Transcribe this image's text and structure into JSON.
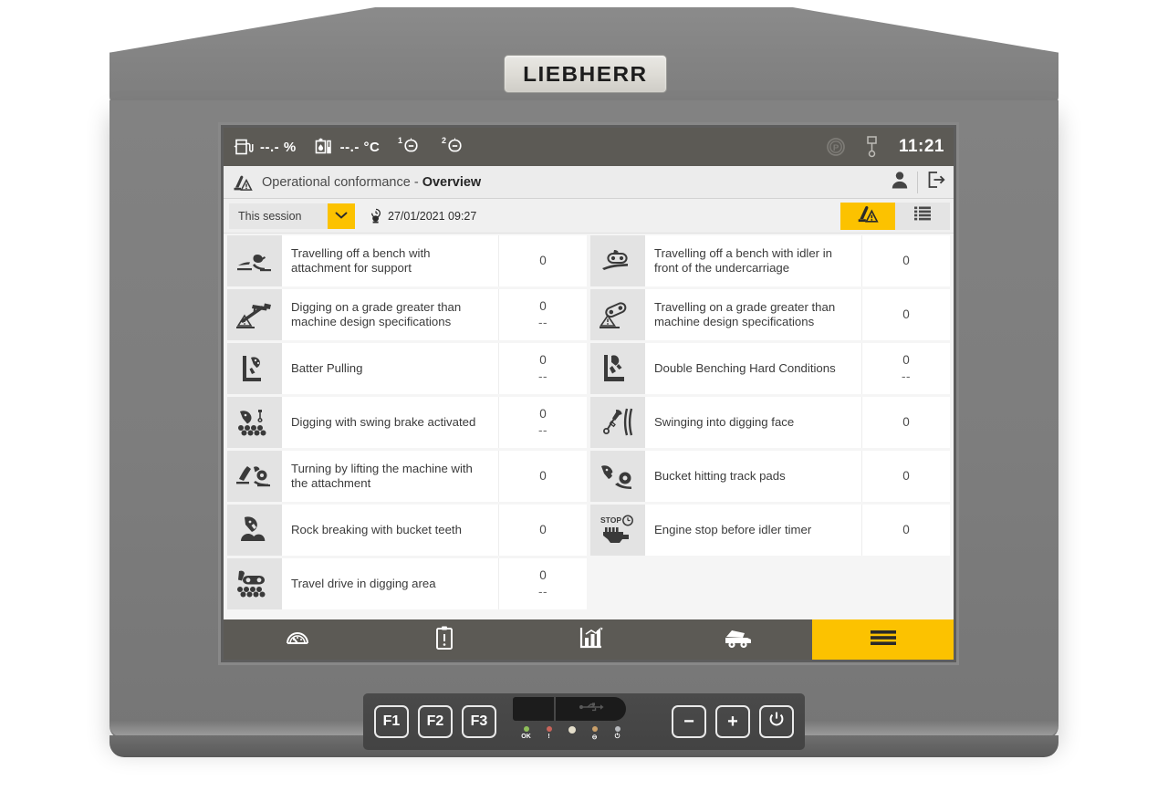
{
  "device": {
    "brand": "LIEBHERR"
  },
  "statusbar": {
    "fuel_icon": "fuel-pump-icon",
    "fuel_value": "--.- %",
    "temp_icon": "oil-temperature-icon",
    "temp_value": "--.- °C",
    "aux1_icon": "aux-tank-1-icon",
    "aux1_value": "--",
    "aux1_superscript": "1",
    "aux2_icon": "aux-tank-2-icon",
    "aux2_value": "--",
    "aux2_superscript": "2",
    "parking_icon": "parking-brake-icon",
    "joystick_icon": "pilot-control-lever-icon",
    "time": "11:21"
  },
  "titlebar": {
    "icon": "operational-conformance-icon",
    "title_prefix": "Operational conformance - ",
    "title_bold": "Overview",
    "user_icon": "user-icon",
    "logout_icon": "logout-icon"
  },
  "filterbar": {
    "session_select_value": "This session",
    "session_select_options": [
      "This session"
    ],
    "dropdown_icon": "chevron-down-icon",
    "date_icon": "clock-session-icon",
    "date_value": "27/01/2021 09:27",
    "view_toggle": [
      {
        "icon": "operational-conformance-icon",
        "active": true,
        "name": "view-conformance"
      },
      {
        "icon": "list-view-icon",
        "active": false,
        "name": "view-list"
      }
    ],
    "accent_color": "#fcc200"
  },
  "table": {
    "left_column": [
      {
        "icon": "travel-off-bench-attachment-icon",
        "label": "Travelling off a bench with attachment for support",
        "value": "0",
        "sub": ""
      },
      {
        "icon": "digging-grade-icon",
        "label": "Digging on a grade greater than machine design specifications",
        "value": "0",
        "sub": "--"
      },
      {
        "icon": "batter-pulling-icon",
        "label": "Batter Pulling",
        "value": "0",
        "sub": "--"
      },
      {
        "icon": "swing-brake-icon",
        "label": "Digging with swing brake activated",
        "value": "0",
        "sub": "--"
      },
      {
        "icon": "turning-by-lifting-icon",
        "label": "Turning by lifting the machine with the attachment",
        "value": "0",
        "sub": ""
      },
      {
        "icon": "rock-breaking-icon",
        "label": "Rock breaking with bucket teeth",
        "value": "0",
        "sub": ""
      },
      {
        "icon": "travel-drive-digging-icon",
        "label": "Travel drive in digging area",
        "value": "0",
        "sub": "--"
      }
    ],
    "right_column": [
      {
        "icon": "travel-off-bench-idler-icon",
        "label": "Travelling off a bench with idler in front of the undercarriage",
        "value": "0",
        "sub": ""
      },
      {
        "icon": "travel-grade-icon",
        "label": "Travelling on a grade greater than machine design specifications",
        "value": "0",
        "sub": ""
      },
      {
        "icon": "double-benching-icon",
        "label": "Double Benching Hard Conditions",
        "value": "0",
        "sub": "--"
      },
      {
        "icon": "swinging-digging-face-icon",
        "label": "Swinging into digging face",
        "value": "0",
        "sub": ""
      },
      {
        "icon": "bucket-track-pads-icon",
        "label": "Bucket hitting track pads",
        "value": "0",
        "sub": ""
      },
      {
        "icon": "engine-stop-idler-icon",
        "label": "Engine stop before idler timer",
        "value": "0",
        "sub": ""
      }
    ]
  },
  "navbar": {
    "items": [
      {
        "name": "nav-dashboard",
        "icon": "gauge-icon",
        "active": false
      },
      {
        "name": "nav-diagnostics",
        "icon": "clipboard-alert-icon",
        "active": false
      },
      {
        "name": "nav-statistics",
        "icon": "bar-chart-icon",
        "active": false
      },
      {
        "name": "nav-machine",
        "icon": "dump-truck-icon",
        "active": false
      },
      {
        "name": "nav-menu",
        "icon": "hamburger-menu-icon",
        "active": true
      }
    ]
  },
  "keypad": {
    "function_keys": [
      "F1",
      "F2",
      "F3"
    ],
    "usb_icon": "usb-icon",
    "leds": [
      {
        "label": "OK",
        "color": "#8fbf5a"
      },
      {
        "label": "!",
        "color": "#c9645a"
      },
      {
        "label": "",
        "color": "#ddd6c0"
      },
      {
        "label": "",
        "color": "#caa06a",
        "icon": "input-power-icon"
      },
      {
        "label": "",
        "color": "#b9bcc0",
        "icon": "power-icon"
      }
    ],
    "led_glyph_3": "⊖",
    "led_glyph_4": "⏻",
    "minus_label": "−",
    "plus_label": "+",
    "power_icon": "power-icon"
  }
}
